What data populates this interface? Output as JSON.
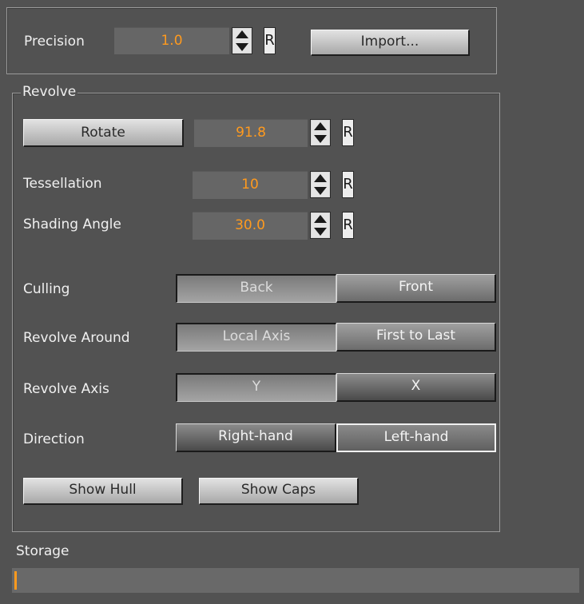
{
  "top": {
    "precision_label": "Precision",
    "precision_value": "1.0",
    "reset_label": "R",
    "import_label": "Import..."
  },
  "revolve": {
    "title": "Revolve",
    "rotate_label": "Rotate",
    "rotate_value": "91.8",
    "tessellation_label": "Tessellation",
    "tessellation_value": "10",
    "shading_angle_label": "Shading Angle",
    "shading_angle_value": "30.0",
    "reset_label": "R",
    "culling": {
      "label": "Culling",
      "options": [
        "Back",
        "Front"
      ],
      "selected": "Back"
    },
    "revolve_around": {
      "label": "Revolve Around",
      "options": [
        "Local Axis",
        "First to Last"
      ],
      "selected": "Local Axis"
    },
    "revolve_axis": {
      "label": "Revolve Axis",
      "options": [
        "Y",
        "X"
      ],
      "selected": "Y"
    },
    "direction": {
      "label": "Direction",
      "options": [
        "Right-hand",
        "Left-hand"
      ],
      "selected": "Left-hand"
    },
    "show_hull_label": "Show Hull",
    "show_caps_label": "Show Caps"
  },
  "storage": {
    "label": "Storage",
    "value": ""
  },
  "colors": {
    "background": "#525252",
    "value_text": "#ff9a1e",
    "text": "#f0f0f0"
  }
}
